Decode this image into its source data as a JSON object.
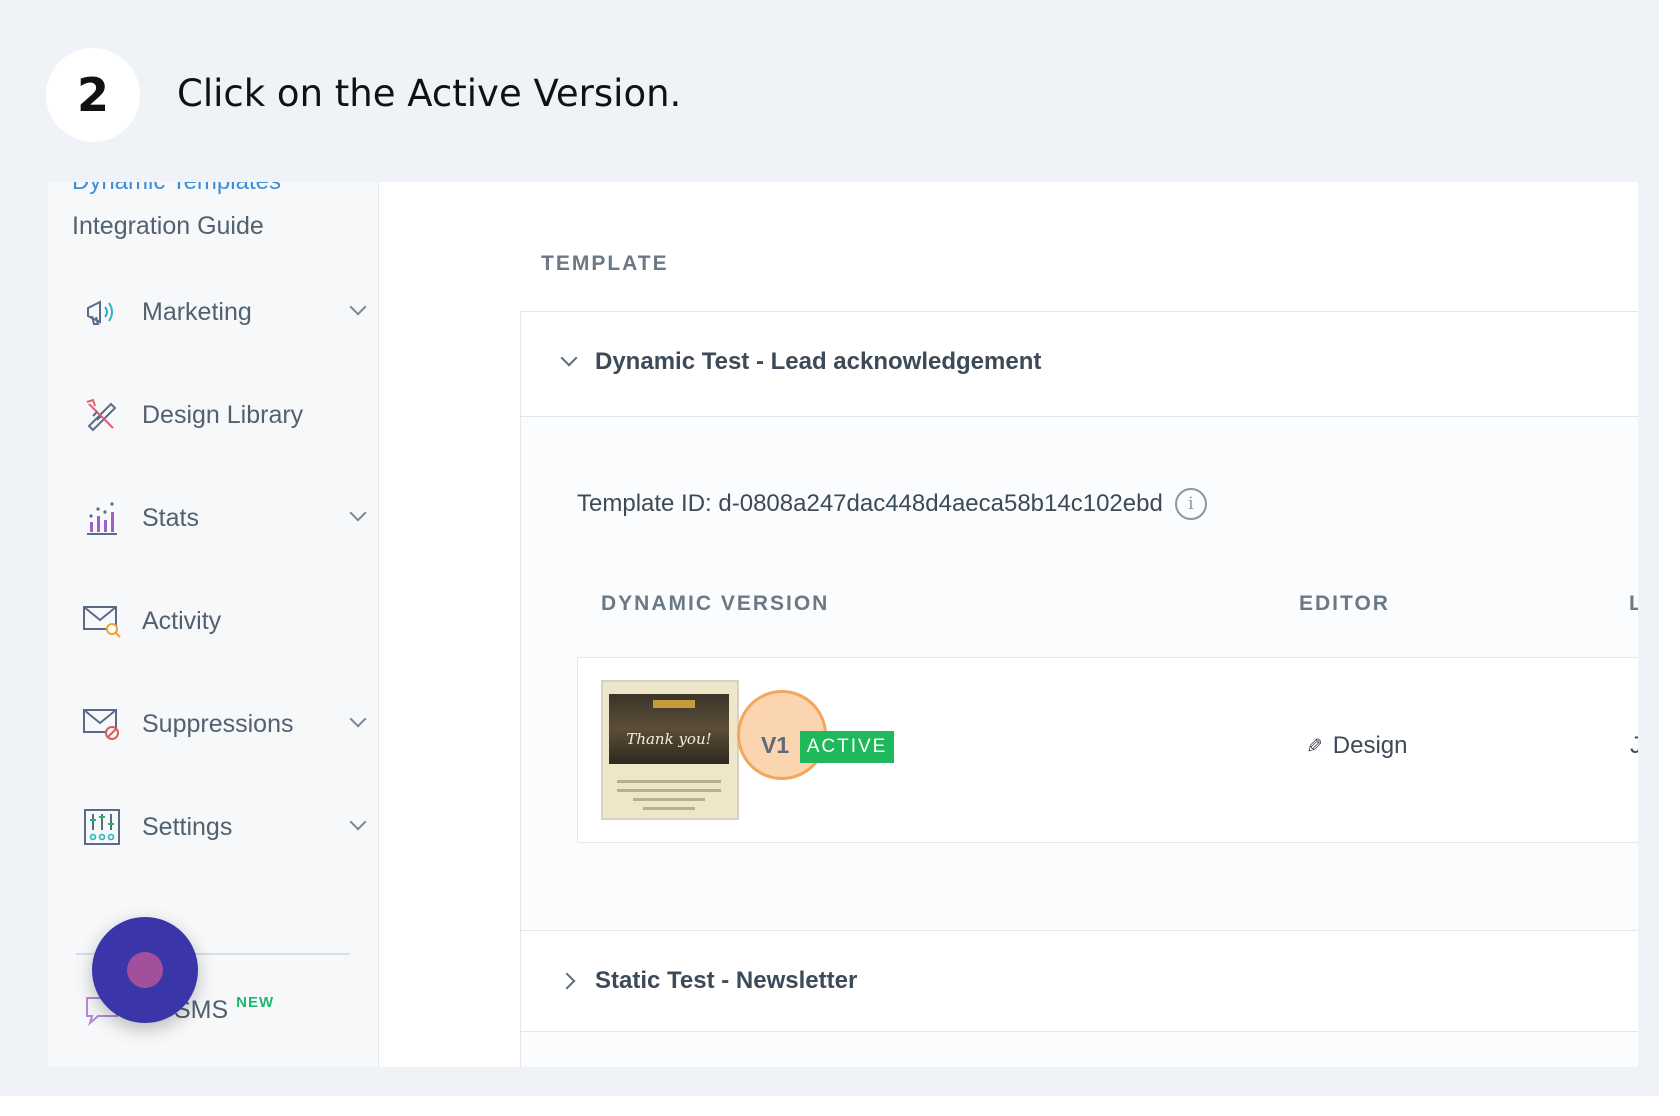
{
  "step": {
    "number": "2",
    "instruction": "Click on the Active Version."
  },
  "sidebar": {
    "cut_link": "Dynamic Templates",
    "integration_guide": "Integration Guide",
    "items": [
      {
        "label": "Marketing",
        "icon": "megaphone-icon",
        "expandable": true
      },
      {
        "label": "Design Library",
        "icon": "design-tools-icon",
        "expandable": false
      },
      {
        "label": "Stats",
        "icon": "bar-chart-icon",
        "expandable": true
      },
      {
        "label": "Activity",
        "icon": "mail-search-icon",
        "expandable": false
      },
      {
        "label": "Suppressions",
        "icon": "mail-block-icon",
        "expandable": true
      },
      {
        "label": "Settings",
        "icon": "sliders-icon",
        "expandable": true
      }
    ],
    "sms": {
      "label": "Twilio SMS",
      "visible_label": "lio SMS",
      "badge": "NEW"
    }
  },
  "main": {
    "section_title": "TEMPLATE",
    "template": {
      "name": "Dynamic Test - Lead acknowledgement",
      "id_label": "Template ID: d-0808a247dac448d4aeca58b14c102ebd",
      "columns": {
        "version": "DYNAMIC VERSION",
        "editor": "EDITOR",
        "last": "L"
      },
      "version": {
        "thumbnail_text": "Thank you!",
        "label": "V1",
        "status": "ACTIVE",
        "editor": "Design",
        "last": "J"
      }
    },
    "second_template": {
      "name": "Static Test - Newsletter"
    }
  },
  "colors": {
    "active": "#1fb85a",
    "highlight": "#f4a65c",
    "chat": "#3a35a8"
  }
}
